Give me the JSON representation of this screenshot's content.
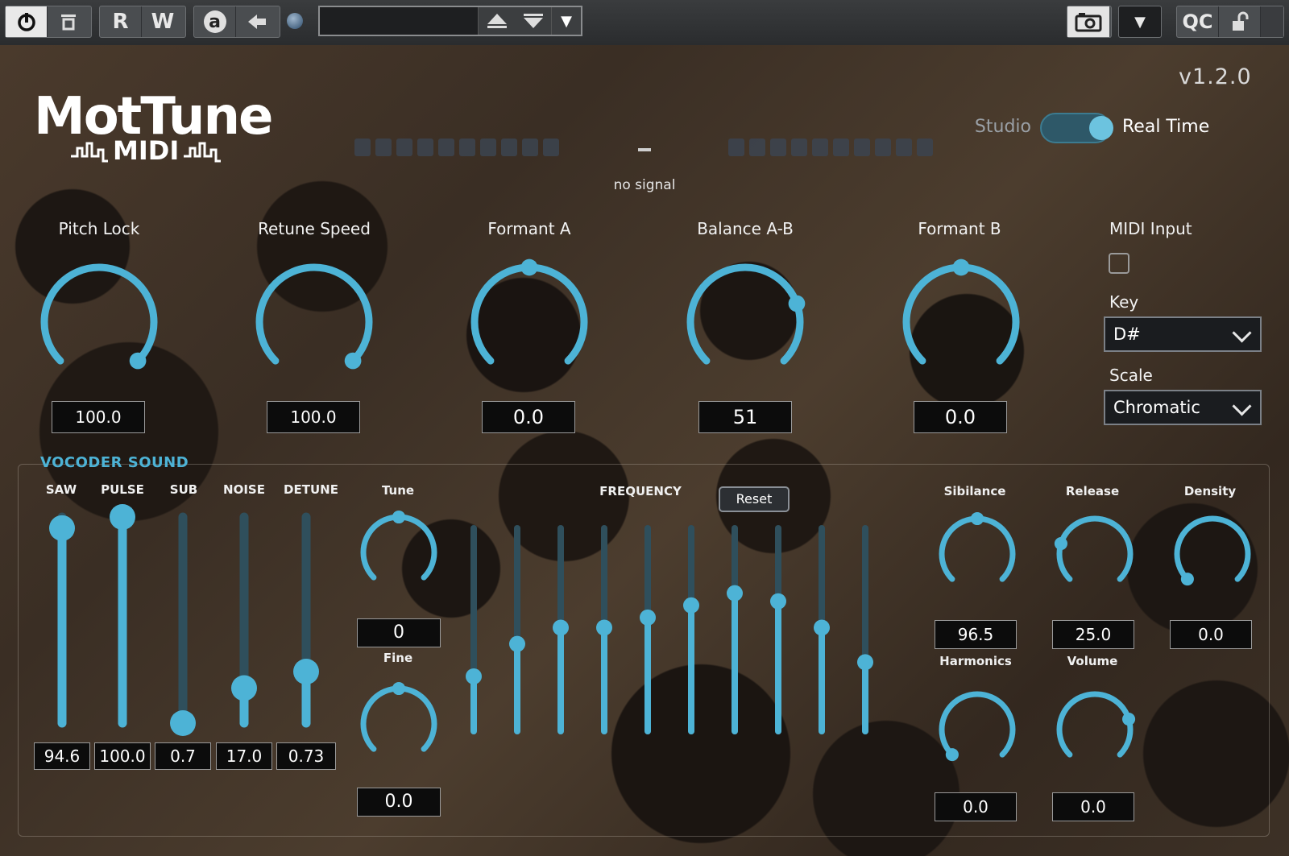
{
  "toolbar": {
    "power_icon": "power-icon",
    "bypass_icon": "bypass-icon",
    "read_label": "R",
    "write_label": "W",
    "auto_label": "a",
    "compare_icon": "back-arrow-icon",
    "preset_name": "",
    "camera_icon": "camera-icon",
    "dropdown_icon": "chevron-down-icon",
    "qc_label": "QC",
    "lock_icon": "unlock-icon"
  },
  "plugin": {
    "logo_title": "MotTune",
    "logo_sub": "MIDI",
    "version": "v1.2.0",
    "signal_status": "no signal",
    "mode_left": "Studio",
    "mode_right": "Real Time",
    "mode_real_time": true,
    "accent_color": "#4db3d6"
  },
  "top_knobs": [
    {
      "label": "Pitch Lock",
      "value": "100.0",
      "level": 1.0
    },
    {
      "label": "Retune Speed",
      "value": "100.0",
      "level": 1.0
    },
    {
      "label": "Formant A",
      "value": "0.0",
      "level": 0.5
    },
    {
      "label": "Balance A-B",
      "value": "51",
      "level": 0.76
    },
    {
      "label": "Formant B",
      "value": "0.0",
      "level": 0.5
    }
  ],
  "midi": {
    "midi_input_label": "MIDI Input",
    "midi_input_checked": false,
    "key_label": "Key",
    "key_value": "D#",
    "scale_label": "Scale",
    "scale_value": "Chromatic"
  },
  "vocoder": {
    "title": "VOCODER SOUND",
    "sliders": [
      {
        "label": "SAW",
        "value": "94.6",
        "level": 0.946
      },
      {
        "label": "PULSE",
        "value": "100.0",
        "level": 1.0
      },
      {
        "label": "SUB",
        "value": "0.7",
        "level": 0.0
      },
      {
        "label": "NOISE",
        "value": "17.0",
        "level": 0.17
      },
      {
        "label": "DETUNE",
        "value": "0.73",
        "level": 0.25
      }
    ],
    "tune": {
      "label": "Tune",
      "value": "0",
      "level": 0.5
    },
    "fine": {
      "label": "Fine",
      "value": "0.0",
      "level": 0.5
    },
    "frequency_label": "FREQUENCY",
    "reset_label": "Reset",
    "frequency_bands": [
      0.27,
      0.43,
      0.51,
      0.51,
      0.56,
      0.62,
      0.68,
      0.64,
      0.51,
      0.34
    ],
    "right_knobs": [
      {
        "label": "Sibilance",
        "value": "96.5",
        "level": 0.5
      },
      {
        "label": "Release",
        "value": "25.0",
        "level": 0.23
      },
      {
        "label": "Density",
        "value": "0.0",
        "level": 0.0
      },
      {
        "label": "Harmonics",
        "value": "0.0",
        "level": 0.0
      },
      {
        "label": "Volume",
        "value": "0.0",
        "level": 0.77
      }
    ]
  }
}
